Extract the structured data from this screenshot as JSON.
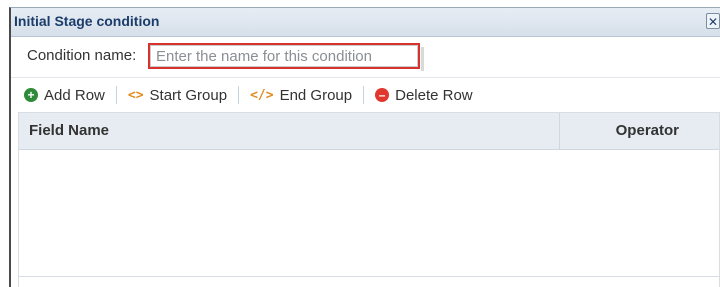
{
  "dialog": {
    "title": "Initial Stage condition",
    "close_glyph": "✕"
  },
  "condition_name": {
    "label": "Condition name:",
    "placeholder": "Enter the name for this condition",
    "value": ""
  },
  "toolbar": {
    "add_row": {
      "label": "Add Row",
      "icon": "plus-circle-icon",
      "color": "#2f8a3a"
    },
    "start_group": {
      "label": "Start Group",
      "icon": "angle-brackets-icon",
      "glyph": "<>",
      "color": "#e08a1e"
    },
    "end_group": {
      "label": "End Group",
      "icon": "code-close-icon",
      "glyph": "</>",
      "color": "#e08a1e"
    },
    "delete_row": {
      "label": "Delete Row",
      "icon": "minus-circle-icon",
      "color": "#e0382e"
    }
  },
  "table": {
    "columns": [
      "Field Name",
      "Operator"
    ],
    "rows": []
  },
  "colors": {
    "title_text": "#1c3d6b",
    "highlight_border": "#d9312b",
    "header_bg": "#e6ecf1"
  }
}
